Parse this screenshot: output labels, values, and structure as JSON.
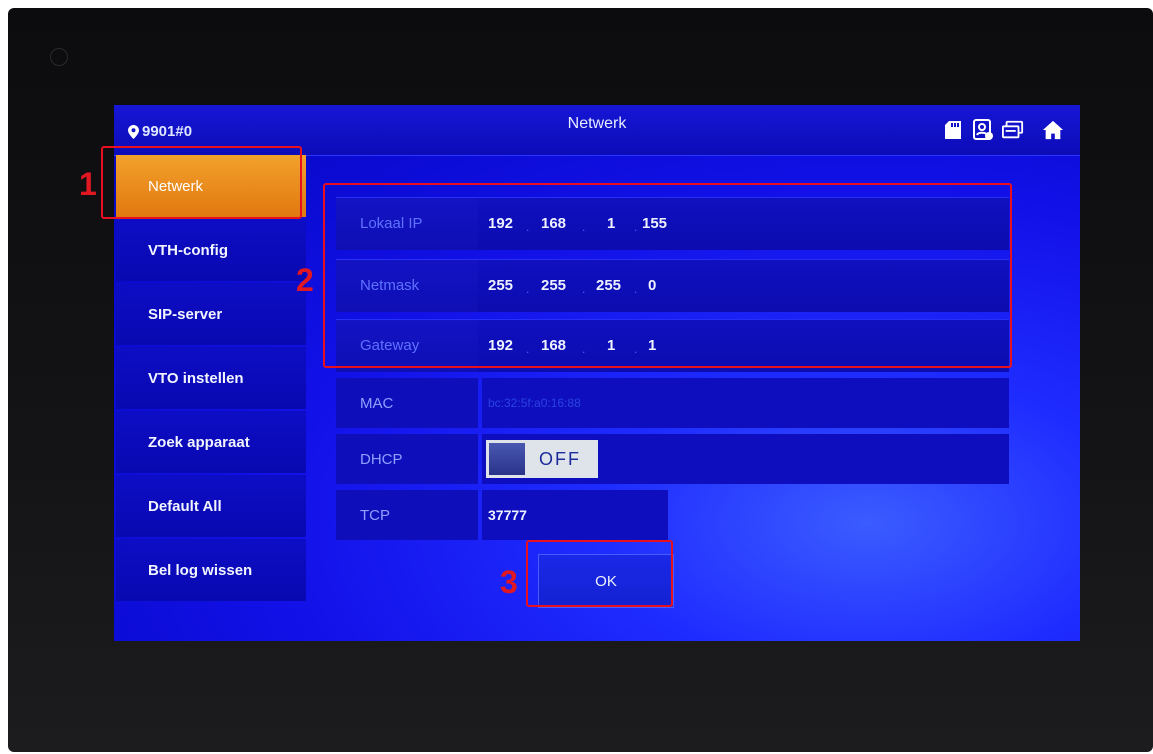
{
  "header": {
    "device_id": "9901#0",
    "title": "Netwerk"
  },
  "icons": [
    "location-pin-icon",
    "sd-card-icon",
    "contact-icon",
    "network-icon",
    "home-icon"
  ],
  "sidebar": {
    "items": [
      {
        "label": "Netwerk",
        "active": true
      },
      {
        "label": "VTH-config"
      },
      {
        "label": "SIP-server"
      },
      {
        "label": "VTO instellen"
      },
      {
        "label": "Zoek apparaat"
      },
      {
        "label": "Default All"
      },
      {
        "label": "Bel log wissen"
      }
    ]
  },
  "network": {
    "local_ip": {
      "label": "Lokaal IP",
      "octets": [
        "192",
        "168",
        "1",
        "155"
      ]
    },
    "netmask": {
      "label": "Netmask",
      "octets": [
        "255",
        "255",
        "255",
        "0"
      ]
    },
    "gateway": {
      "label": "Gateway",
      "octets": [
        "192",
        "168",
        "1",
        "1"
      ]
    },
    "mac": {
      "label": "MAC",
      "value": "bc:32:5f:a0:16:88"
    },
    "dhcp": {
      "label": "DHCP",
      "state": "OFF"
    },
    "tcp": {
      "label": "TCP",
      "value": "37777"
    }
  },
  "ok_button": "OK",
  "annotations": {
    "n1": "1",
    "n2": "2",
    "n3": "3"
  },
  "colors": {
    "highlight": "#e8101e",
    "active_tab": "#f3a12d",
    "screen_blue": "#1211e8"
  }
}
